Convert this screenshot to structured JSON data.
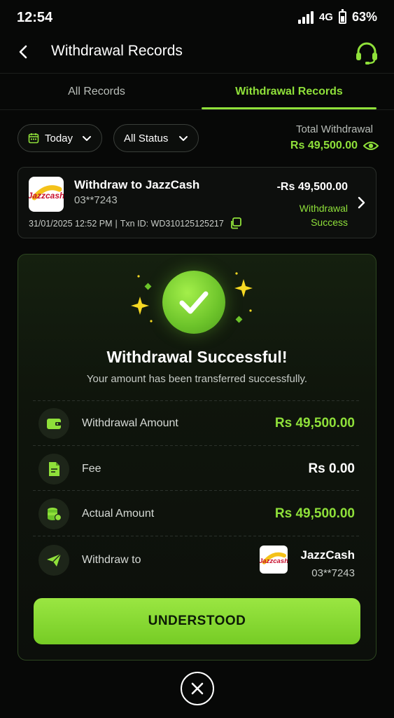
{
  "status_bar": {
    "time": "12:54",
    "network": "4G",
    "battery": "63%"
  },
  "header": {
    "title": "Withdrawal Records"
  },
  "tabs": [
    {
      "label": "All Records"
    },
    {
      "label": "Withdrawal Records"
    }
  ],
  "filters": {
    "date": "Today",
    "status": "All Status",
    "total_label": "Total Withdrawal",
    "total_value": "Rs 49,500.00"
  },
  "record": {
    "logo_text": "Jazzcash",
    "title": "Withdraw to JazzCash",
    "account": "03**7243",
    "datetime": "31/01/2025 12:52 PM",
    "separator": "|",
    "txn": "Txn ID: WD310125125217",
    "amount": "-Rs 49,500.00",
    "status_line1": "Withdrawal",
    "status_line2": "Success"
  },
  "success": {
    "title": "Withdrawal Successful!",
    "subtitle": "Your amount has been transferred successfully.",
    "rows": [
      {
        "label": "Withdrawal Amount",
        "value": "Rs 49,500.00"
      },
      {
        "label": "Fee",
        "value": "Rs 0.00"
      },
      {
        "label": "Actual Amount",
        "value": "Rs 49,500.00"
      },
      {
        "label": "Withdraw to"
      }
    ],
    "withdraw_to_name": "JazzCash",
    "withdraw_to_account": "03**7243",
    "button_label": "UNDERSTOOD"
  },
  "colors": {
    "accent": "#8fe03a",
    "background": "#070807"
  },
  "icons": [
    "back-arrow-icon",
    "headset-icon",
    "calendar-icon",
    "chevron-down-icon",
    "eye-icon",
    "copy-icon",
    "chevron-right-icon",
    "check-icon",
    "sparkle-icon",
    "wallet-icon",
    "document-icon",
    "coins-icon",
    "send-icon",
    "close-icon"
  ]
}
